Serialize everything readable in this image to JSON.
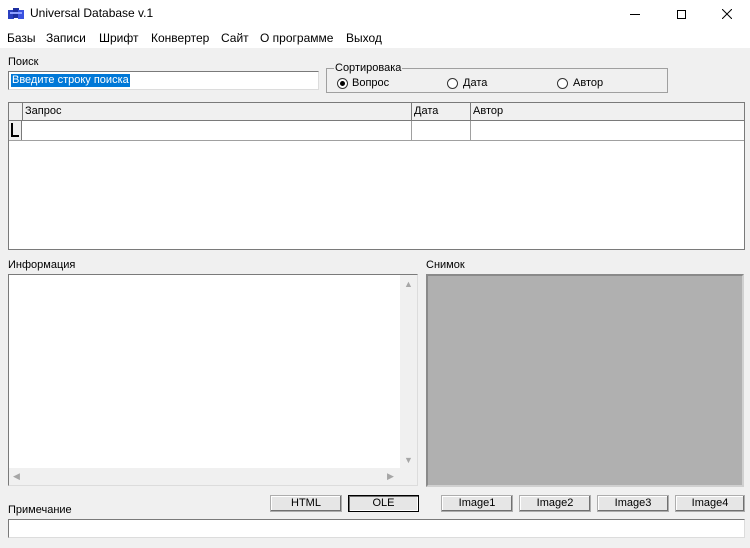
{
  "window": {
    "title": "Universal Database v.1",
    "icon": "database-app-icon"
  },
  "menu": {
    "items": [
      "Базы",
      "Записи",
      "Шрифт",
      "Конвертер",
      "Сайт",
      "О программе",
      "Выход"
    ]
  },
  "search": {
    "label": "Поиск",
    "value": "Введите строку поиска"
  },
  "sort": {
    "legend": "Сортировака",
    "options": [
      "Вопрос",
      "Дата",
      "Автор"
    ],
    "selected": "Вопрос"
  },
  "grid": {
    "columns": [
      "Запрос",
      "Дата",
      "Автор"
    ],
    "rows": [
      [
        "",
        "",
        ""
      ]
    ]
  },
  "info": {
    "label": "Информация",
    "value": ""
  },
  "snapshot": {
    "label": "Снимок",
    "panel_color": "#b0b0b0"
  },
  "buttons": {
    "html": "HTML",
    "ole": "OLE",
    "image1": "Image1",
    "image2": "Image2",
    "image3": "Image3",
    "image4": "Image4"
  },
  "note": {
    "label": "Примечание",
    "value": ""
  },
  "colors": {
    "selection": "#0078d7",
    "background": "#f0f0f0"
  }
}
